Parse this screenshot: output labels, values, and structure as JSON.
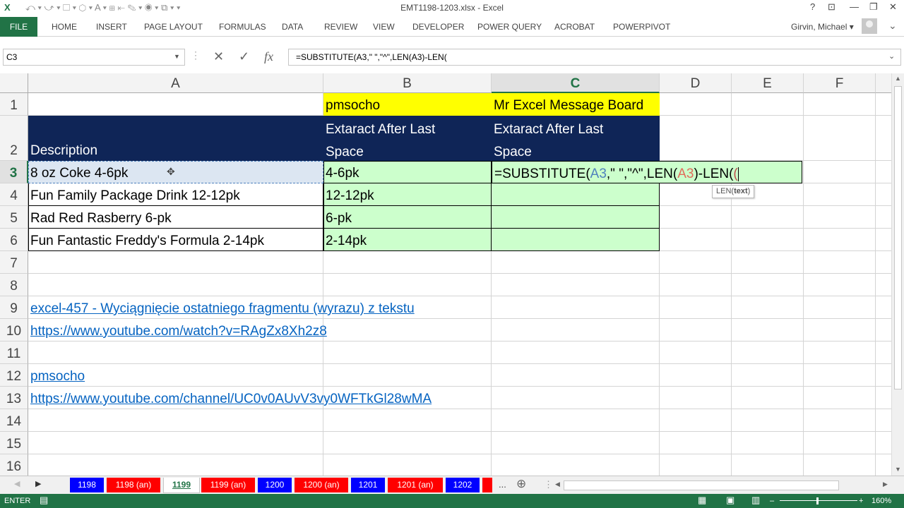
{
  "window": {
    "title": "EMT1198-1203.xlsx - Excel",
    "help": "?",
    "minimize": "—",
    "restore": "❐",
    "close": "✕"
  },
  "ribbon": {
    "file": "FILE",
    "tabs": [
      "HOME",
      "INSERT",
      "PAGE LAYOUT",
      "FORMULAS",
      "DATA",
      "REVIEW",
      "VIEW",
      "DEVELOPER",
      "POWER QUERY",
      "ACROBAT",
      "POWERPIVOT"
    ],
    "user": "Girvin, Michael"
  },
  "formula_bar": {
    "name_box": "C3",
    "formula": "=SUBSTITUTE(A3,\" \",\"^\",LEN(A3)-LEN("
  },
  "columns": [
    "A",
    "B",
    "C",
    "D",
    "E",
    "F"
  ],
  "rows": [
    "1",
    "2",
    "3",
    "4",
    "5",
    "6",
    "7",
    "8",
    "9",
    "10",
    "11",
    "12",
    "13",
    "14",
    "15",
    "16"
  ],
  "cells": {
    "B1": "pmsocho",
    "C1": "Mr Excel Message Board",
    "A2": "Description",
    "B2a": "Extaract After Last",
    "B2b": "Space",
    "C2a": "Extaract After Last",
    "C2b": "Space",
    "A3": "8 oz Coke 4-6pk",
    "B3": "4-6pk",
    "A4": "Fun Family Package Drink 12-12pk",
    "B4": "12-12pk",
    "A5": "Rad Red Rasberry 6-pk",
    "B5": "6-pk",
    "A6": "Fun Fantastic Freddy's Formula 2-14pk",
    "B6": "2-14pk",
    "A9": "excel-457 - Wyciągnięcie ostatniego fragmentu (wyrazu) z tekstu",
    "A10": "https://www.youtube.com/watch?v=RAgZx8Xh2z8",
    "A12": "pmsocho",
    "A13": "https://www.youtube.com/channel/UC0v0AUvV3vy0WFTkGl28wMA"
  },
  "edit": {
    "p1": "=SUBSTITUTE(",
    "p2": "A3",
    "p3": ",\" \",\"^\",LEN(",
    "p4": "A3",
    "p5": ")-LEN(",
    "p6": "("
  },
  "tooltip": {
    "fn": "LEN(",
    "arg": "text",
    "close": ")"
  },
  "sheets": [
    {
      "label": "1198",
      "color": "blue"
    },
    {
      "label": "1198 (an)",
      "color": "red"
    },
    {
      "label": "1199",
      "color": "active"
    },
    {
      "label": "1199 (an)",
      "color": "red"
    },
    {
      "label": "1200",
      "color": "blue"
    },
    {
      "label": "1200 (an)",
      "color": "red"
    },
    {
      "label": "1201",
      "color": "blue"
    },
    {
      "label": "1201 (an)",
      "color": "red"
    },
    {
      "label": "1202",
      "color": "blue"
    }
  ],
  "sheet_more": "...",
  "status": {
    "mode": "ENTER",
    "zoom": "160%"
  },
  "colors": {
    "excel_green": "#217346",
    "header_navy": "#0f2557",
    "yellow": "#ffff00",
    "light_green": "#ccffcc",
    "tab_blue": "#0000ff",
    "tab_red": "#ff0000",
    "ref_blue": "#4f81bd",
    "ref_red": "#e26b5a"
  }
}
